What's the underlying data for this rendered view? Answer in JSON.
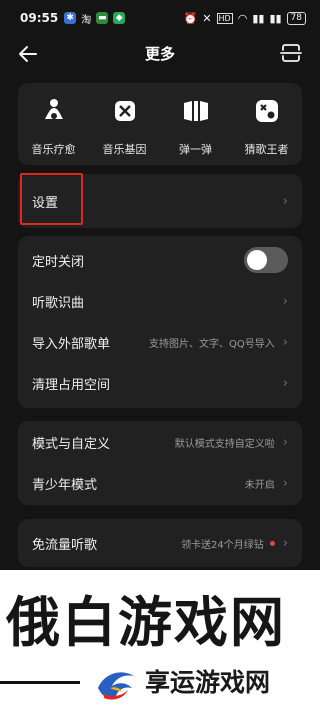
{
  "status_bar": {
    "time": "09:55",
    "app1": "淘",
    "battery": "78"
  },
  "header": {
    "title": "更多"
  },
  "features": [
    {
      "label": "音乐疗愈",
      "icon": "meditation-icon"
    },
    {
      "label": "音乐基因",
      "icon": "dna-icon"
    },
    {
      "label": "弹一弹",
      "icon": "piano-icon"
    },
    {
      "label": "猜歌王者",
      "icon": "music-quiz-icon"
    }
  ],
  "settings": {
    "label": "设置"
  },
  "group1": {
    "timer": {
      "label": "定时关闭",
      "toggle_on": false
    },
    "song_recognition": {
      "label": "听歌识曲"
    },
    "import_playlist": {
      "label": "导入外部歌单",
      "sub": "支持图片、文字、QQ号导入"
    },
    "clear_space": {
      "label": "清理占用空间"
    }
  },
  "group2": {
    "mode": {
      "label": "模式与自定义",
      "sub": "默认模式支持自定义啦"
    },
    "youth": {
      "label": "青少年模式",
      "sub": "未开启"
    }
  },
  "group3": {
    "free_data": {
      "label": "免流量听歌",
      "sub": "领卡送24个月绿钻"
    }
  },
  "watermark": {
    "top": "俄白游戏网",
    "bottom": "享运游戏网"
  },
  "colors": {
    "background": "#141414",
    "card": "#212121",
    "highlight": "#e0281c",
    "badge_dot": "#e64545"
  }
}
